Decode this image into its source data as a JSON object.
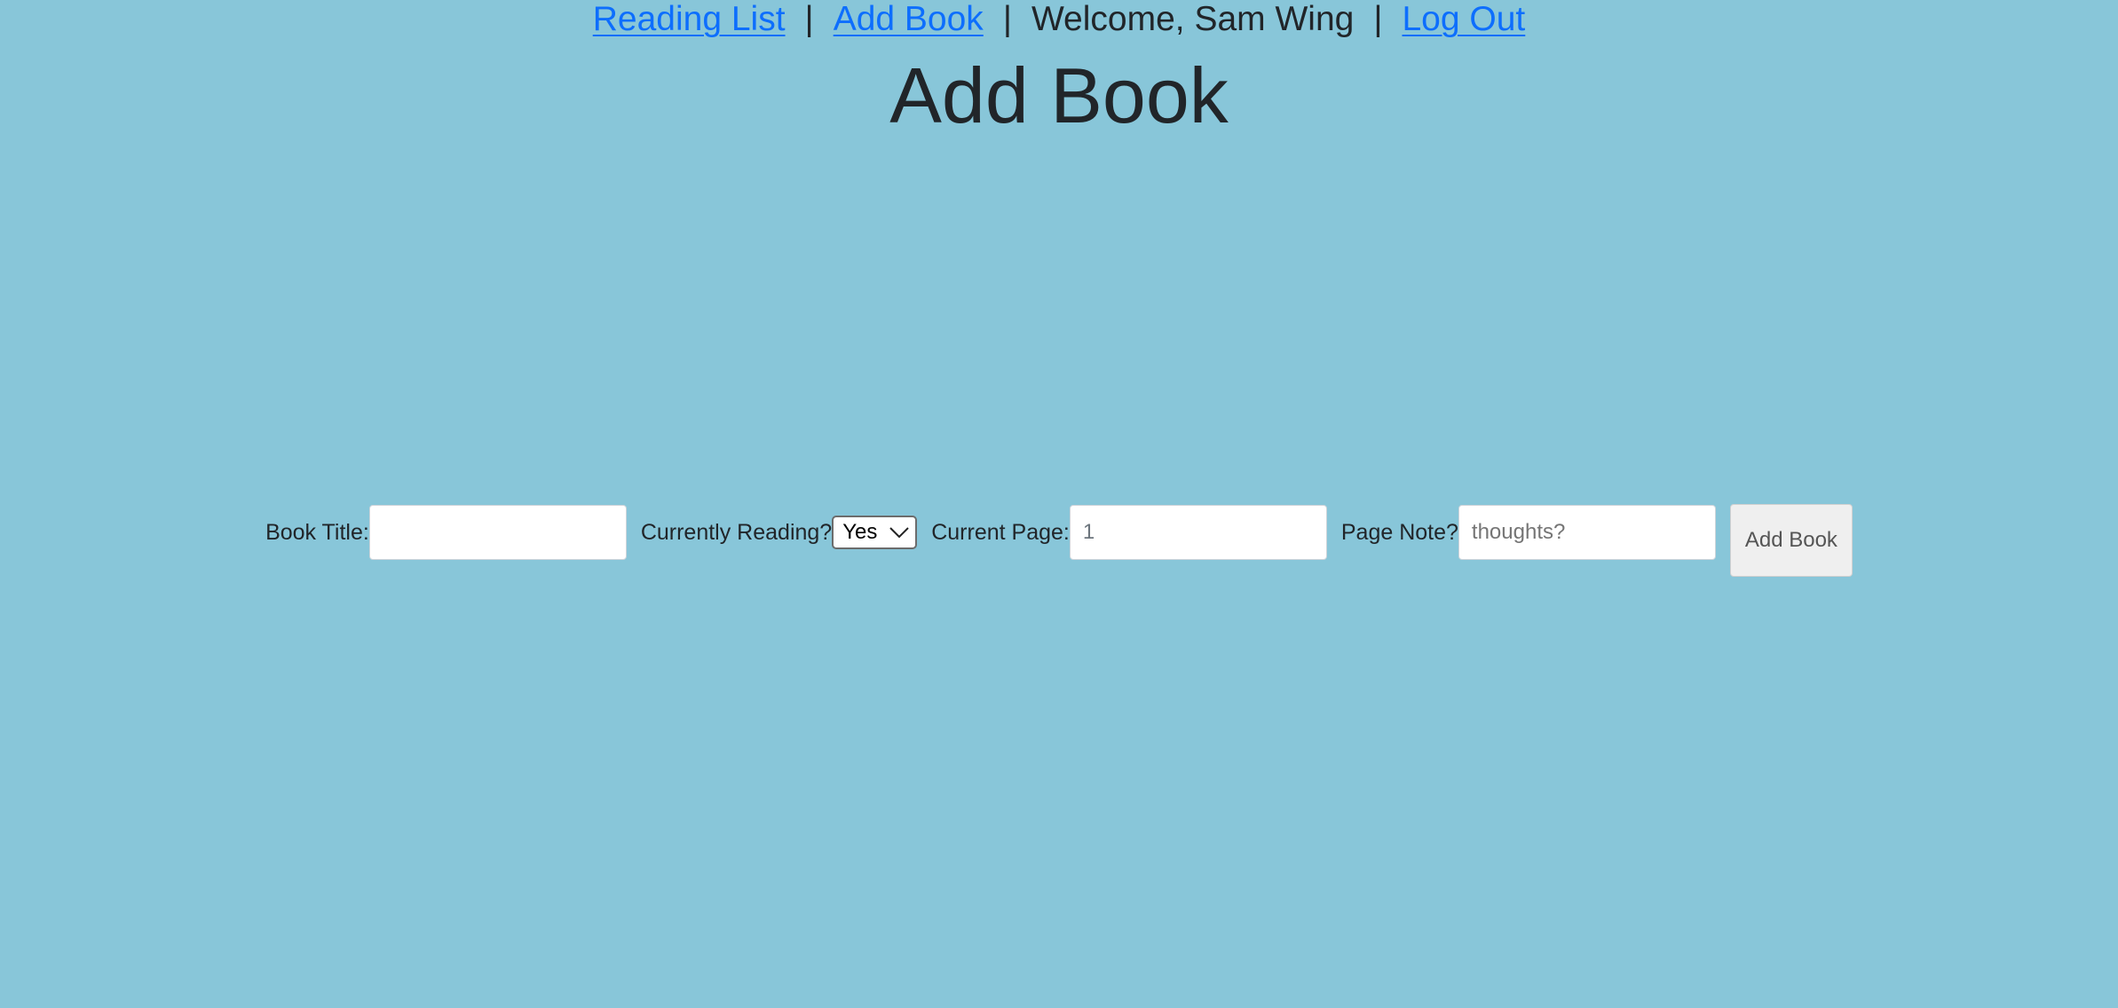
{
  "nav": {
    "reading_list": "Reading List",
    "add_book": "Add Book",
    "separator": "|",
    "welcome": "Welcome, Sam Wing",
    "log_out": "Log Out"
  },
  "page": {
    "title": "Add Book"
  },
  "form": {
    "book_title_label": "Book Title:",
    "book_title_value": "",
    "currently_reading_label": "Currently Reading?",
    "currently_reading_value": "Yes",
    "current_page_label": "Current Page:",
    "current_page_value": "1",
    "page_note_label": "Page Note?",
    "page_note_placeholder": "thoughts?",
    "submit_label": "Add Book"
  },
  "colors": {
    "background": "#88c6d9",
    "link": "#0d6efd"
  }
}
